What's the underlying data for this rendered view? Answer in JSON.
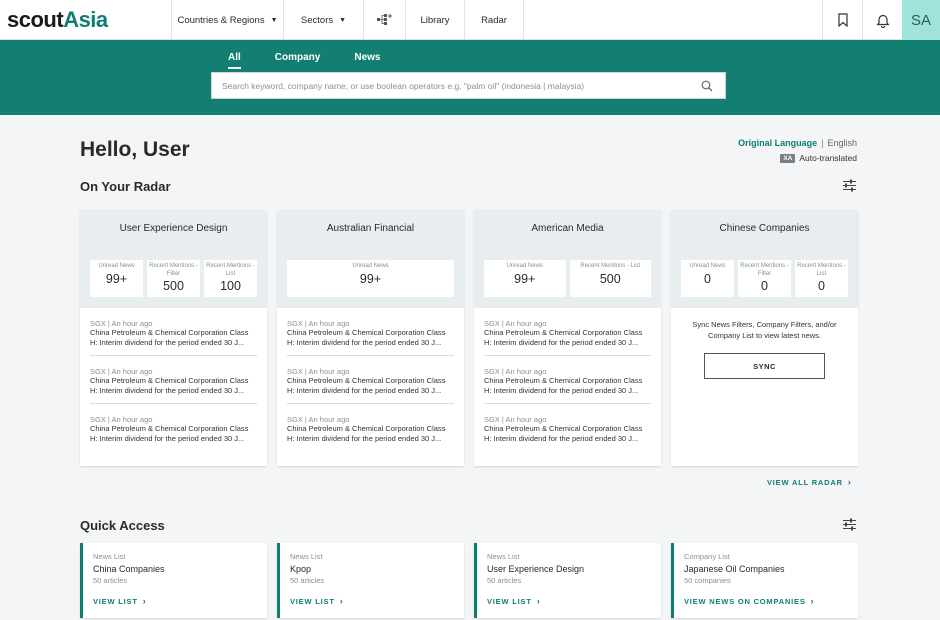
{
  "brand": {
    "part1": "scout",
    "part2": "Asia"
  },
  "nav": {
    "countries": "Countries & Regions",
    "sectors": "Sectors",
    "library": "Library",
    "radar": "Radar",
    "avatar": "SA"
  },
  "search": {
    "tabs": [
      "All",
      "Company",
      "News"
    ],
    "placeholder": "Search keyword, company name, or use boolean operators e.g. \"palm oil\" (indonesia | malaysia)"
  },
  "greeting": "Hello, User",
  "language": {
    "original": "Original Language",
    "separator": "|",
    "english": "English",
    "badge": "XA",
    "auto": "Auto-translated"
  },
  "radar": {
    "title": "On Your Radar",
    "cards": [
      {
        "title": "User Experience Design",
        "stats": [
          {
            "label": "Unread News",
            "value": "99+"
          },
          {
            "label": "Recent Mentions - Filter",
            "value": "500"
          },
          {
            "label": "Recent Mentions - List",
            "value": "100"
          }
        ],
        "news": [
          {
            "meta": "SGX  |  An hour ago",
            "line1": "China Petroleum & Chemical Corporation Class",
            "line2": "H: Interim dividend for the period ended 30 J..."
          },
          {
            "meta": "SGX  |  An hour ago",
            "line1": "China Petroleum & Chemical Corporation Class",
            "line2": "H: Interim dividend for the period ended 30 J..."
          },
          {
            "meta": "SGX  |  An hour ago",
            "line1": "China Petroleum & Chemical Corporation Class",
            "line2": "H: Interim dividend for the period ended 30 J..."
          }
        ]
      },
      {
        "title": "Australian Financial",
        "stats": [
          {
            "label": "Unread News",
            "value": "99+"
          }
        ],
        "news": [
          {
            "meta": "SGX  |  An hour ago",
            "line1": "China Petroleum & Chemical Corporation Class",
            "line2": "H: Interim dividend for the period ended 30 J..."
          },
          {
            "meta": "SGX  |  An hour ago",
            "line1": "China Petroleum & Chemical Corporation Class",
            "line2": "H: Interim dividend for the period ended 30 J..."
          },
          {
            "meta": "SGX  |  An hour ago",
            "line1": "China Petroleum & Chemical Corporation Class",
            "line2": "H: Interim dividend for the period ended 30 J..."
          }
        ]
      },
      {
        "title": "American Media",
        "stats": [
          {
            "label": "Unread News",
            "value": "99+"
          },
          {
            "label": "Recent Mentions - List",
            "value": "500"
          }
        ],
        "news": [
          {
            "meta": "SGX  |  An hour ago",
            "line1": "China Petroleum & Chemical Corporation Class",
            "line2": "H: Interim dividend for the period ended 30 J..."
          },
          {
            "meta": "SGX  |  An hour ago",
            "line1": "China Petroleum & Chemical Corporation Class",
            "line2": "H: Interim dividend for the period ended 30 J..."
          },
          {
            "meta": "SGX  |  An hour ago",
            "line1": "China Petroleum & Chemical Corporation Class",
            "line2": "H: Interim dividend for the period ended 30 J..."
          }
        ]
      },
      {
        "title": "Chinese Companies",
        "stats": [
          {
            "label": "Unread News",
            "value": "0"
          },
          {
            "label": "Recent Mentions - Filter",
            "value": "0"
          },
          {
            "label": "Recent Mentions - List",
            "value": "0"
          }
        ],
        "sync_message": "Sync News Filters, Company Filters, and/or Company List to view latest news.",
        "sync_label": "SYNC"
      }
    ],
    "view_all": "VIEW ALL RADAR"
  },
  "quick_access": {
    "title": "Quick Access",
    "items": [
      {
        "type": "News List",
        "name": "China Companies",
        "count": "50 articles",
        "link": "VIEW LIST"
      },
      {
        "type": "News List",
        "name": "Kpop",
        "count": "50 articles",
        "link": "VIEW LIST"
      },
      {
        "type": "News List",
        "name": "User Experience Design",
        "count": "50 articles",
        "link": "VIEW LIST"
      },
      {
        "type": "Company List",
        "name": "Japanese Oil Companies",
        "count": "50 companies",
        "link": "VIEW NEWS ON COMPANIES"
      }
    ]
  },
  "icons": {
    "caret": "caret-down-icon",
    "network": "network-icon",
    "bookmark": "bookmark-icon",
    "bell": "bell-icon",
    "search": "search-icon",
    "filter": "filter-sliders-icon",
    "chevron": "chevron-right-icon"
  },
  "colors": {
    "brand": "#0f7d72",
    "band": "#137f72",
    "avatar": "#9fe3db",
    "page": "#f3f5f7",
    "card_head": "#e8eef0"
  }
}
